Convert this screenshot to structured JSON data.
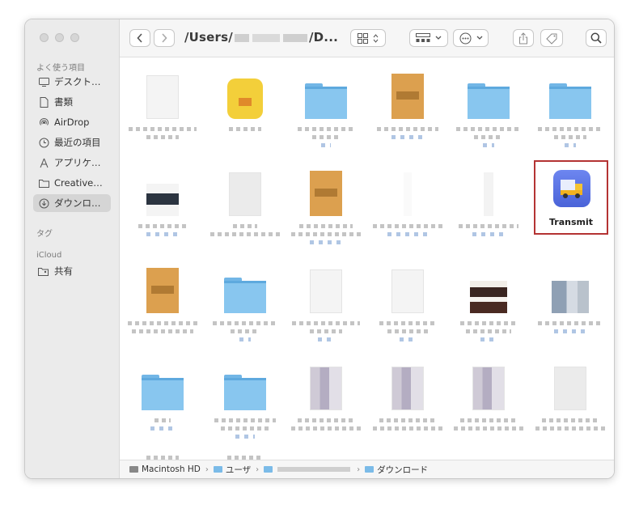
{
  "window": {
    "path_title_start": "/Users/",
    "path_title_end": "/D..."
  },
  "sidebar": {
    "favorites_header": "よく使う項目",
    "items": [
      {
        "label": "デスクト…",
        "icon": "desktop-icon"
      },
      {
        "label": "書類",
        "icon": "document-icon"
      },
      {
        "label": "AirDrop",
        "icon": "airdrop-icon"
      },
      {
        "label": "最近の項目",
        "icon": "clock-icon"
      },
      {
        "label": "アプリケ…",
        "icon": "applications-icon"
      },
      {
        "label": "Creative…",
        "icon": "folder-icon"
      },
      {
        "label": "ダウンロ…",
        "icon": "download-icon",
        "active": true
      }
    ],
    "tags_header": "タグ",
    "icloud_header": "iCloud",
    "icloud_items": [
      {
        "label": "共有",
        "icon": "shared-folder-icon"
      }
    ]
  },
  "toolbar": {
    "back_icon": "chevron-left-icon",
    "forward_icon": "chevron-right-icon",
    "view_icon": "grid-view-icon",
    "group_icon": "group-by-icon",
    "action_icon": "ellipsis-circle-icon",
    "share_icon": "share-icon",
    "tag_icon": "tag-icon",
    "search_icon": "search-icon"
  },
  "content": {
    "highlighted_app": {
      "label": "Transmit",
      "icon": "transmit-app-icon",
      "highlight_color": "#b43333"
    }
  },
  "statusbar": {
    "crumbs": [
      "Macintosh HD",
      "ユーザ",
      "",
      "ダウンロード"
    ]
  }
}
